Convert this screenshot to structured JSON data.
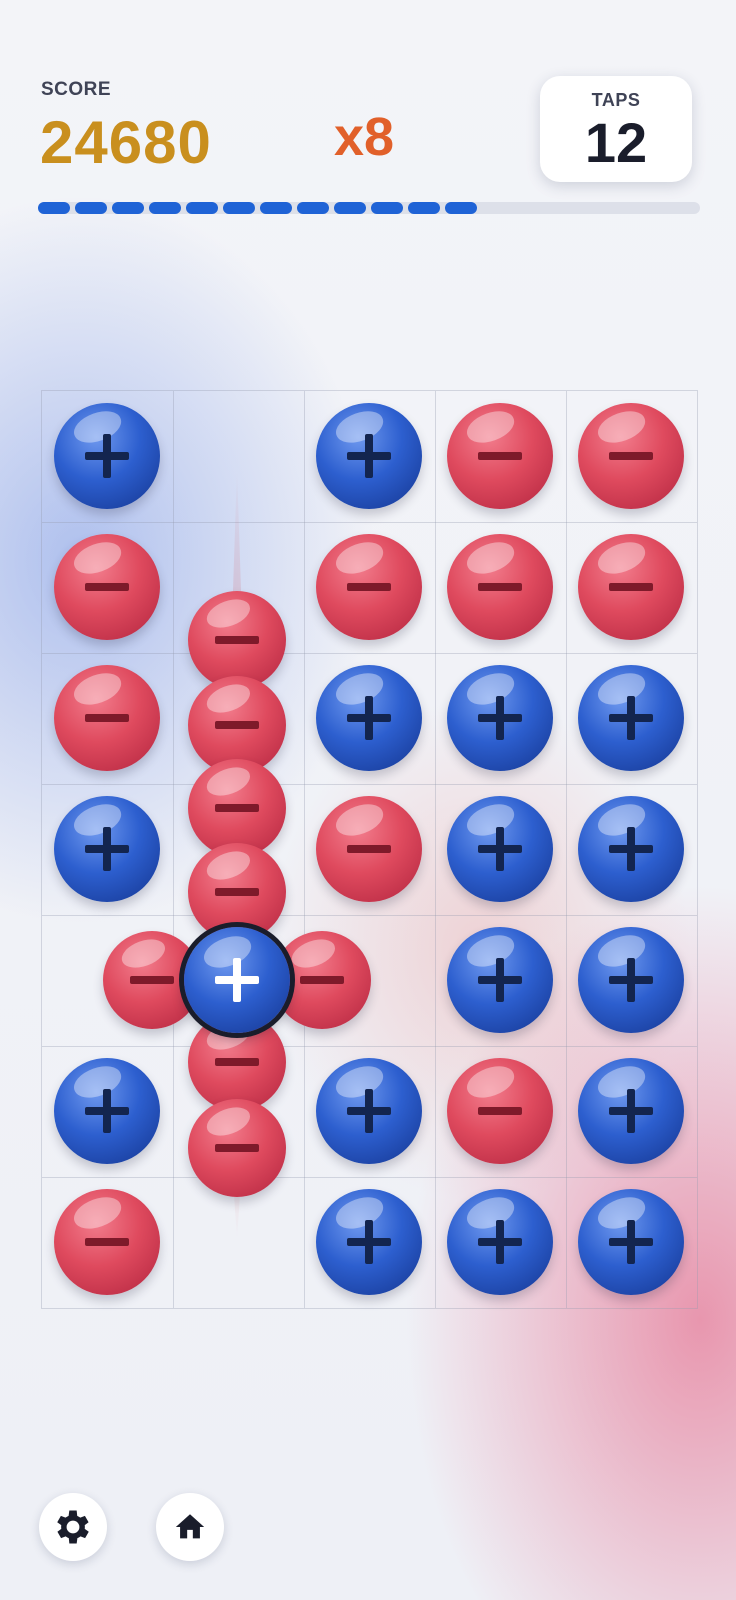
{
  "hud": {
    "score_label": "SCORE",
    "score_value": "24680",
    "multiplier": "x8",
    "taps_label": "TAPS",
    "taps_value": "12",
    "progress_segments_filled": 12,
    "colors": {
      "score": "#c98f1e",
      "multiplier": "#e1602a",
      "progress": "#1f63d6"
    }
  },
  "board": {
    "columns": 5,
    "rows": 7,
    "cells": [
      [
        "plus",
        null,
        "plus",
        "minus",
        "minus"
      ],
      [
        "minus",
        null,
        "minus",
        "minus",
        "minus"
      ],
      [
        "minus",
        null,
        "plus",
        "plus",
        "plus"
      ],
      [
        "plus",
        null,
        "minus",
        "plus",
        "plus"
      ],
      [
        null,
        null,
        null,
        "plus",
        "plus"
      ],
      [
        "plus",
        null,
        "plus",
        "minus",
        "plus"
      ],
      [
        "minus",
        null,
        "plus",
        "plus",
        "plus"
      ]
    ],
    "active_charge": "plus",
    "flying_charges": [
      "minus",
      "minus",
      "minus",
      "minus",
      "minus",
      "minus",
      "minus",
      "minus"
    ],
    "colors": {
      "plus": "#2d5fcf",
      "minus": "#df4a5e"
    }
  },
  "footer": {
    "settings_icon": "gear-icon",
    "home_icon": "home-icon"
  }
}
